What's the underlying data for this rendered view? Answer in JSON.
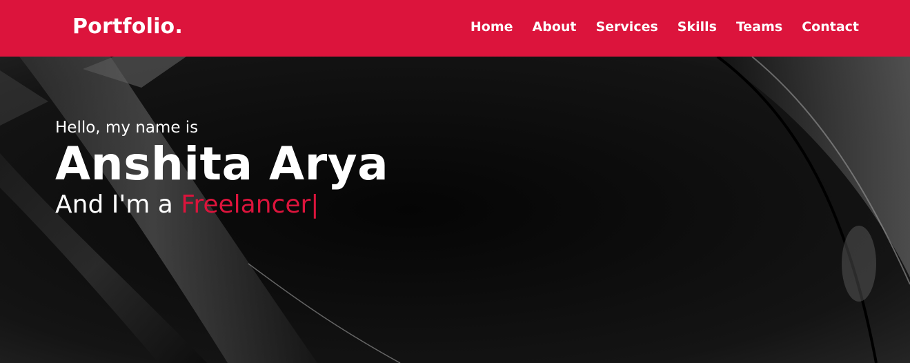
{
  "navbar": {
    "brand": "Portfolio",
    "brand_dot": ".",
    "links": [
      "Home",
      "About",
      "Services",
      "Skills",
      "Teams",
      "Contact"
    ],
    "background_color": "#dc143c"
  },
  "hero": {
    "greeting": "Hello, my name is",
    "name": "Anshita Arya",
    "role_prefix": "And I'm a ",
    "role": "Freelancer",
    "cursor": "|",
    "accent_color": "#dc143c"
  }
}
